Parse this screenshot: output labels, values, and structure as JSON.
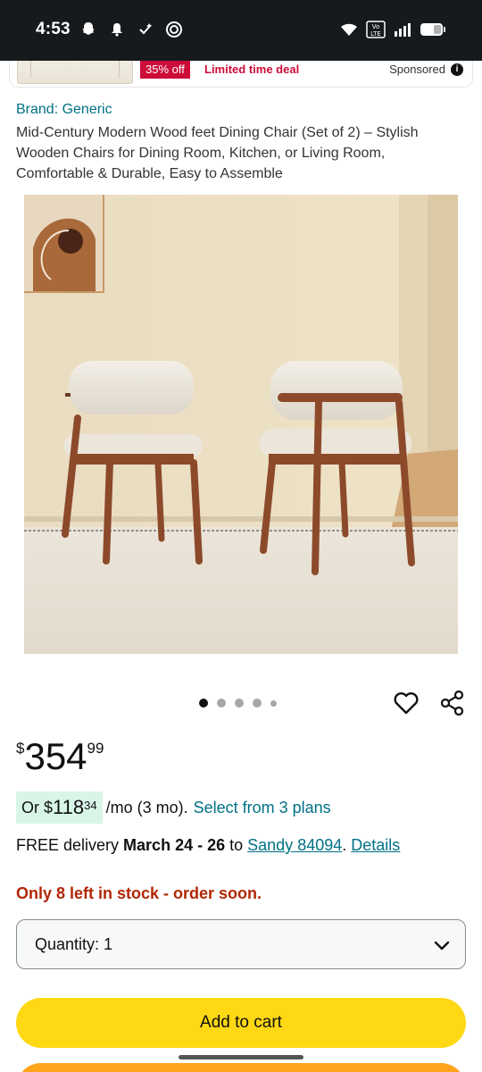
{
  "status_bar": {
    "time": "4:53",
    "left_icons": [
      "snapchat-icon",
      "bell-icon",
      "assistant-icon",
      "signal-app-icon"
    ],
    "right_icons": [
      "wifi-icon",
      "volte-icon",
      "cell-signal-icon",
      "battery-icon"
    ],
    "volte_text": "Vo LTE"
  },
  "sponsored_ad": {
    "discount": "35% off",
    "deal_label": "Limited time deal",
    "sponsored_label": "Sponsored"
  },
  "product": {
    "brand_link": "Brand: Generic",
    "title": "Mid-Century Modern Wood feet Dining Chair (Set of 2) – Stylish Wooden Chairs for Dining Room, Kitchen, or Living Room, Comfortable & Durable, Easy to Assemble",
    "image_count": 5,
    "active_image_index": 0
  },
  "price": {
    "symbol": "$",
    "whole": "354",
    "fraction": "99"
  },
  "installment": {
    "prefix": "Or",
    "symbol": "$",
    "whole": "118",
    "fraction": "34",
    "suffix": "/mo (3 mo).",
    "plans_link": "Select from 3 plans"
  },
  "delivery": {
    "prefix": "FREE delivery",
    "dates": "March 24 - 26",
    "to": "to",
    "location": "Sandy 84094",
    "period": ".",
    "details_link": "Details"
  },
  "stock": {
    "message": "Only 8 left in stock - order soon."
  },
  "quantity": {
    "label": "Quantity:",
    "value": "1"
  },
  "buttons": {
    "add_to_cart": "Add to cart"
  },
  "colors": {
    "link": "#007185",
    "price_red": "#b12704",
    "add_to_cart_bg": "#ffd814",
    "buy_now_bg": "#ffa41c",
    "deal_red": "#cc0c39",
    "installment_highlight": "#d8f5e8"
  }
}
